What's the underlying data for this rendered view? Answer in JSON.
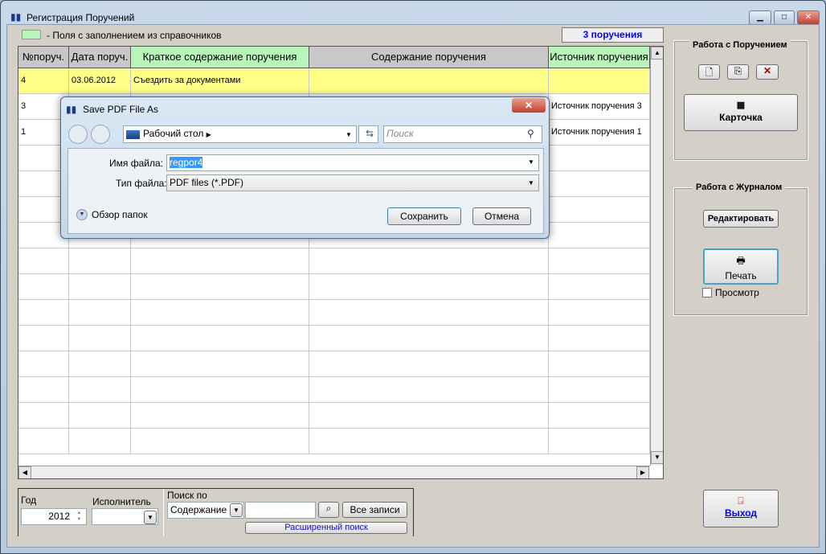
{
  "window": {
    "title": "Регистрация Поручений",
    "min": "▁",
    "max": "□",
    "close": "✕"
  },
  "legend_text": "- Поля с заполнением из справочников",
  "count_badge": "3 поручения",
  "grid": {
    "columns": [
      "№поруч.",
      "Дата поруч.",
      "Краткое содержание поручения",
      "Содержание поручения",
      "Источник поручения"
    ],
    "rows": [
      [
        "4",
        "03.06.2012",
        "Съездить за документами",
        "",
        ""
      ],
      [
        "3",
        "",
        "",
        "",
        "Источник поручения 3"
      ],
      [
        "1",
        "",
        "",
        "",
        "Источник поручения 1"
      ]
    ]
  },
  "panel_order": {
    "title": "Работа с Поручением",
    "card": "Карточка"
  },
  "panel_journal": {
    "title": "Работа с Журналом",
    "edit": "Редактировать",
    "print": "Печать",
    "preview": "Просмотр"
  },
  "exit": "Выход",
  "filters": {
    "year_label": "Год",
    "year": "2012",
    "executor_label": "Исполнитель",
    "search_by_label": "Поиск по",
    "search_field": "Содержание",
    "all_records": "Все записи",
    "advanced": "Расширенный поиск"
  },
  "dialog": {
    "title": "Save PDF File As",
    "location": "Рабочий стол",
    "search_placeholder": "Поиск",
    "filename_label": "Имя файла:",
    "filename": "regpor4",
    "filetype_label": "Тип файла:",
    "filetype": "PDF files (*.PDF)",
    "browse": "Обзор папок",
    "save": "Сохранить",
    "cancel": "Отмена"
  },
  "colors": {
    "highlight_row": "#ffff88",
    "lookup_field": "#b8f5b8",
    "badge_text": "#0000ff"
  }
}
